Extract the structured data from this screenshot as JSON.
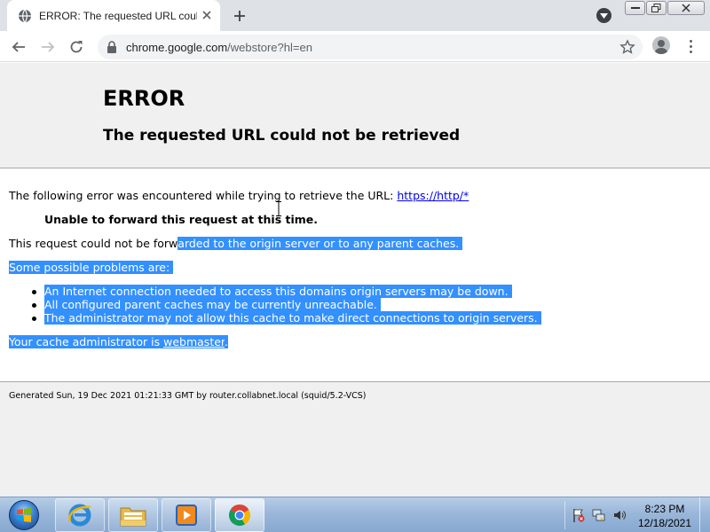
{
  "browser": {
    "tab_title": "ERROR: The requested URL could not be retrieved",
    "url_host": "chrome.google.com",
    "url_path": "/webstore?hl=en"
  },
  "page": {
    "heading": "ERROR",
    "subheading": "The requested URL could not be retrieved",
    "intro_text": "The following error was encountered while trying to retrieve the URL: ",
    "intro_link": "https://http/*",
    "error_reason": "Unable to forward this request at this time.",
    "request_text_a": "This request could not be forw",
    "request_text_b": "arded to the origin server or to any parent caches.",
    "problems_heading": "Some possible problems are:",
    "problems": [
      "An Internet connection needed to access this domains origin servers may be down.",
      "All configured parent caches may be currently unreachable.",
      "The administrator may not allow this cache to make direct connections to origin servers."
    ],
    "admin_text": "Your cache administrator is ",
    "admin_link": "webmaster",
    "admin_end": ".",
    "footer": "Generated Sun, 19 Dec 2021 01:21:33 GMT by router.collabnet.local (squid/5.2-VCS)"
  },
  "taskbar": {
    "clock_time": "8:23 PM",
    "clock_date": "12/18/2021",
    "pinned": [
      "internet-explorer",
      "windows-explorer",
      "media-player",
      "google-chrome"
    ]
  },
  "colors": {
    "selection": "#3390ff",
    "link": "#0000ee",
    "header_bg": "#f0f0f0"
  }
}
